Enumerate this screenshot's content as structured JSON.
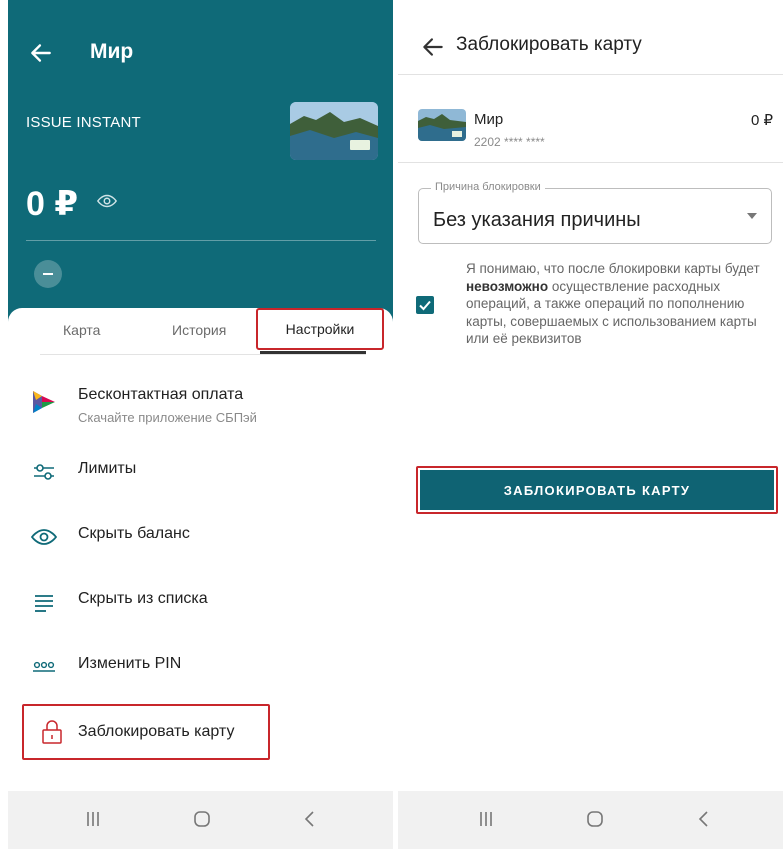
{
  "left": {
    "title": "Мир",
    "product": "ISSUE INSTANT",
    "balance": "0 ₽",
    "tabs": [
      {
        "label": "Карта"
      },
      {
        "label": "История"
      },
      {
        "label": "Настройки"
      }
    ],
    "menu": [
      {
        "label": "Бесконтактная оплата",
        "sub": "Скачайте приложение СБПэй",
        "icon": "sbp-pay-icon"
      },
      {
        "label": "Лимиты",
        "icon": "sliders-icon"
      },
      {
        "label": "Скрыть баланс",
        "icon": "eye-icon"
      },
      {
        "label": "Скрыть из списка",
        "icon": "list-icon"
      },
      {
        "label": "Изменить PIN",
        "icon": "pin-dots-icon"
      },
      {
        "label": "Заблокировать карту",
        "icon": "lock-icon"
      }
    ]
  },
  "right": {
    "title": "Заблокировать карту",
    "card": {
      "name": "Мир",
      "number": "2202 **** ****",
      "balance": "0 ₽"
    },
    "reason": {
      "label": "Причина блокировки",
      "value": "Без указания причины"
    },
    "consent": {
      "before": "Я понимаю, что после блокировки карты будет ",
      "emphasis": "невозможно",
      "after": " осуществление расходных операций, а также операций по пополнению карты, совершаемых с использованием карты или её реквизитов",
      "checked": true
    },
    "button": "ЗАБЛОКИРОВАТЬ КАРТУ"
  },
  "colors": {
    "brand_teal": "#0f6a78",
    "button_teal": "#0f6373",
    "highlight_red": "#c8262b"
  }
}
